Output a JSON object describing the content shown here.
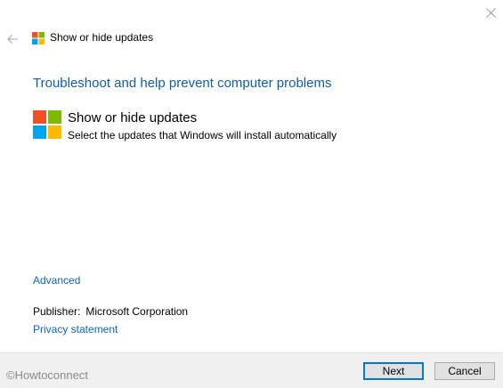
{
  "window": {
    "title": "Show or hide updates"
  },
  "icons": {
    "close": "close-icon",
    "back": "back-arrow-icon",
    "logo": "windows-logo-icon"
  },
  "main": {
    "heading": "Troubleshoot and help prevent computer problems",
    "item": {
      "title": "Show or hide updates",
      "description": "Select the updates that Windows will install automatically"
    },
    "advanced_link": "Advanced",
    "publisher_label": "Publisher:",
    "publisher_value": "Microsoft Corporation",
    "privacy_link": "Privacy statement"
  },
  "footer": {
    "watermark": "©Howtoconnect",
    "next_label": "Next",
    "cancel_label": "Cancel"
  },
  "colors": {
    "accent": "#0078d7",
    "link": "#0e65b8",
    "logo_red": "#f25022",
    "logo_green": "#7fba00",
    "logo_blue": "#00a4ef",
    "logo_yellow": "#ffb900"
  }
}
